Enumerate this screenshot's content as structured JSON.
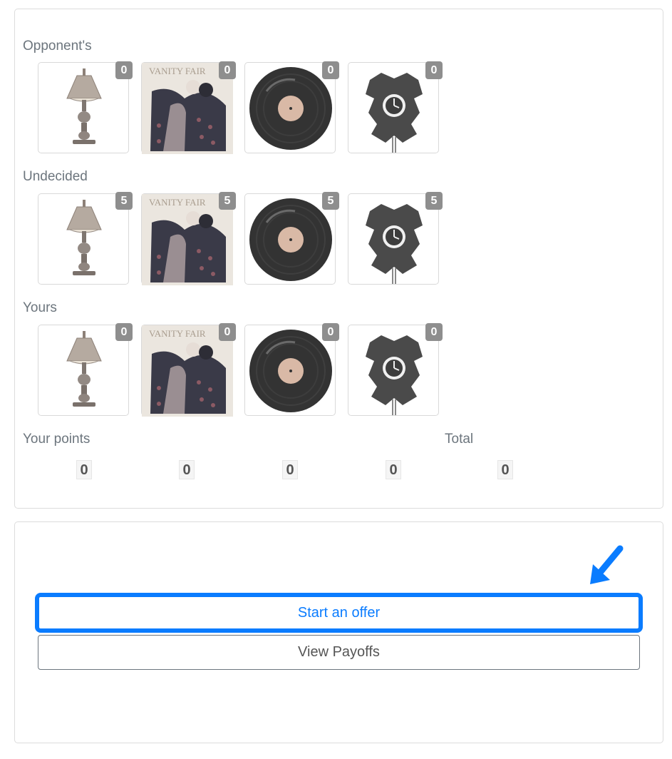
{
  "rows": [
    {
      "label": "Opponent's",
      "counts": [
        "0",
        "0",
        "0",
        "0"
      ]
    },
    {
      "label": "Undecided",
      "counts": [
        "5",
        "5",
        "5",
        "5"
      ]
    },
    {
      "label": "Yours",
      "counts": [
        "0",
        "0",
        "0",
        "0"
      ]
    }
  ],
  "items": [
    "lamp-icon",
    "vanity-fair-poster-icon",
    "vinyl-record-icon",
    "cuckoo-clock-icon"
  ],
  "points": {
    "label": "Your points",
    "total_label": "Total",
    "values": [
      "0",
      "0",
      "0",
      "0"
    ],
    "total": "0"
  },
  "actions": {
    "start_offer": "Start an offer",
    "view_payoffs": "View Payoffs"
  },
  "colors": {
    "accent": "#0a7cff",
    "badge": "#8e8e8e",
    "text": "#6c757d"
  }
}
